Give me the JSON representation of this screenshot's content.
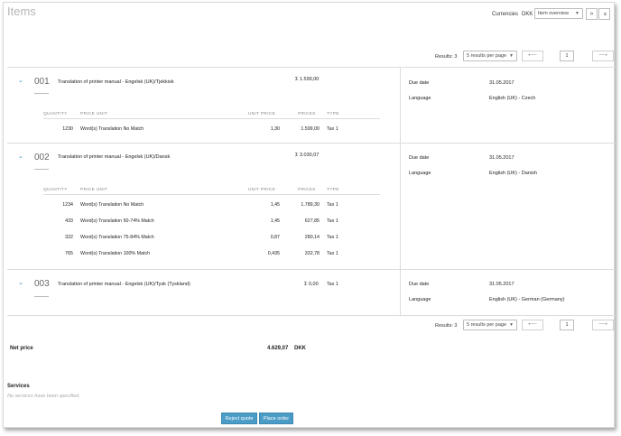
{
  "header": {
    "title": "Items",
    "currencies_label": "Currencies",
    "currency": "DKK",
    "view_select": "Item overview",
    "expand_icon": "double-chevron-right-icon",
    "collapse_icon": "double-chevron-down-icon"
  },
  "pagination": {
    "results_label": "Results: 3",
    "per_page": "5 results per page",
    "page": "1",
    "prev_icon": "arrow-left-icon",
    "next_icon": "arrow-right-icon"
  },
  "table_headers": {
    "quantity": "QUANTITY",
    "price_unit": "PRICE UNIT",
    "unit_price": "UNIT PRICE",
    "prices": "PRICES",
    "type": "TYPE"
  },
  "side_labels": {
    "due_date": "Due date",
    "language": "Language"
  },
  "items": [
    {
      "number": "001",
      "title": "Translation of printer manual - Engelsk (UK)/Tjekkisk",
      "total": "Σ 1.599,00",
      "due_date": "31.05.2017",
      "language": "English (UK) - Czech",
      "rows": [
        {
          "quantity": "1230",
          "price_unit": "Word(s) Translation No Match",
          "unit_price": "1,30",
          "price": "1.599,00",
          "type": "Tax 1"
        }
      ]
    },
    {
      "number": "002",
      "title": "Translation of printer manual - Engelsk (UK)/Dansk",
      "total": "Σ 3.030,07",
      "due_date": "31.05.2017",
      "language": "English (UK) - Danish",
      "rows": [
        {
          "quantity": "1234",
          "price_unit": "Word(s) Translation No Match",
          "unit_price": "1,45",
          "price": "1.789,30",
          "type": "Tax 1"
        },
        {
          "quantity": "433",
          "price_unit": "Word(s) Translation 50-74% Match",
          "unit_price": "1,45",
          "price": "627,85",
          "type": "Tax 1"
        },
        {
          "quantity": "322",
          "price_unit": "Word(s) Translation 75-84% Match",
          "unit_price": "0,87",
          "price": "280,14",
          "type": "Tax 1"
        },
        {
          "quantity": "765",
          "price_unit": "Word(s) Translation 100% Match",
          "unit_price": "0,435",
          "price": "332,78",
          "type": "Tax 1"
        }
      ]
    },
    {
      "number": "003",
      "title": "Translation of printer manual - Engelsk (UK)/Tysk (Tyskland)",
      "total": "Σ 0,00",
      "type": "Tax 1",
      "due_date": "31.05.2017",
      "language": "English (UK) - German (Germany)",
      "rows": []
    }
  ],
  "net_price": {
    "label": "Net price",
    "value": "4.629,07",
    "currency": "DKK"
  },
  "services": {
    "heading": "Services",
    "empty_text": "No services have been specified."
  },
  "actions": {
    "reject": "Reject quote",
    "order": "Place order"
  },
  "colors": {
    "accent": "#4a9cc6",
    "chevron": "#2a8fb8",
    "title_gray": "#b5b5b5"
  }
}
